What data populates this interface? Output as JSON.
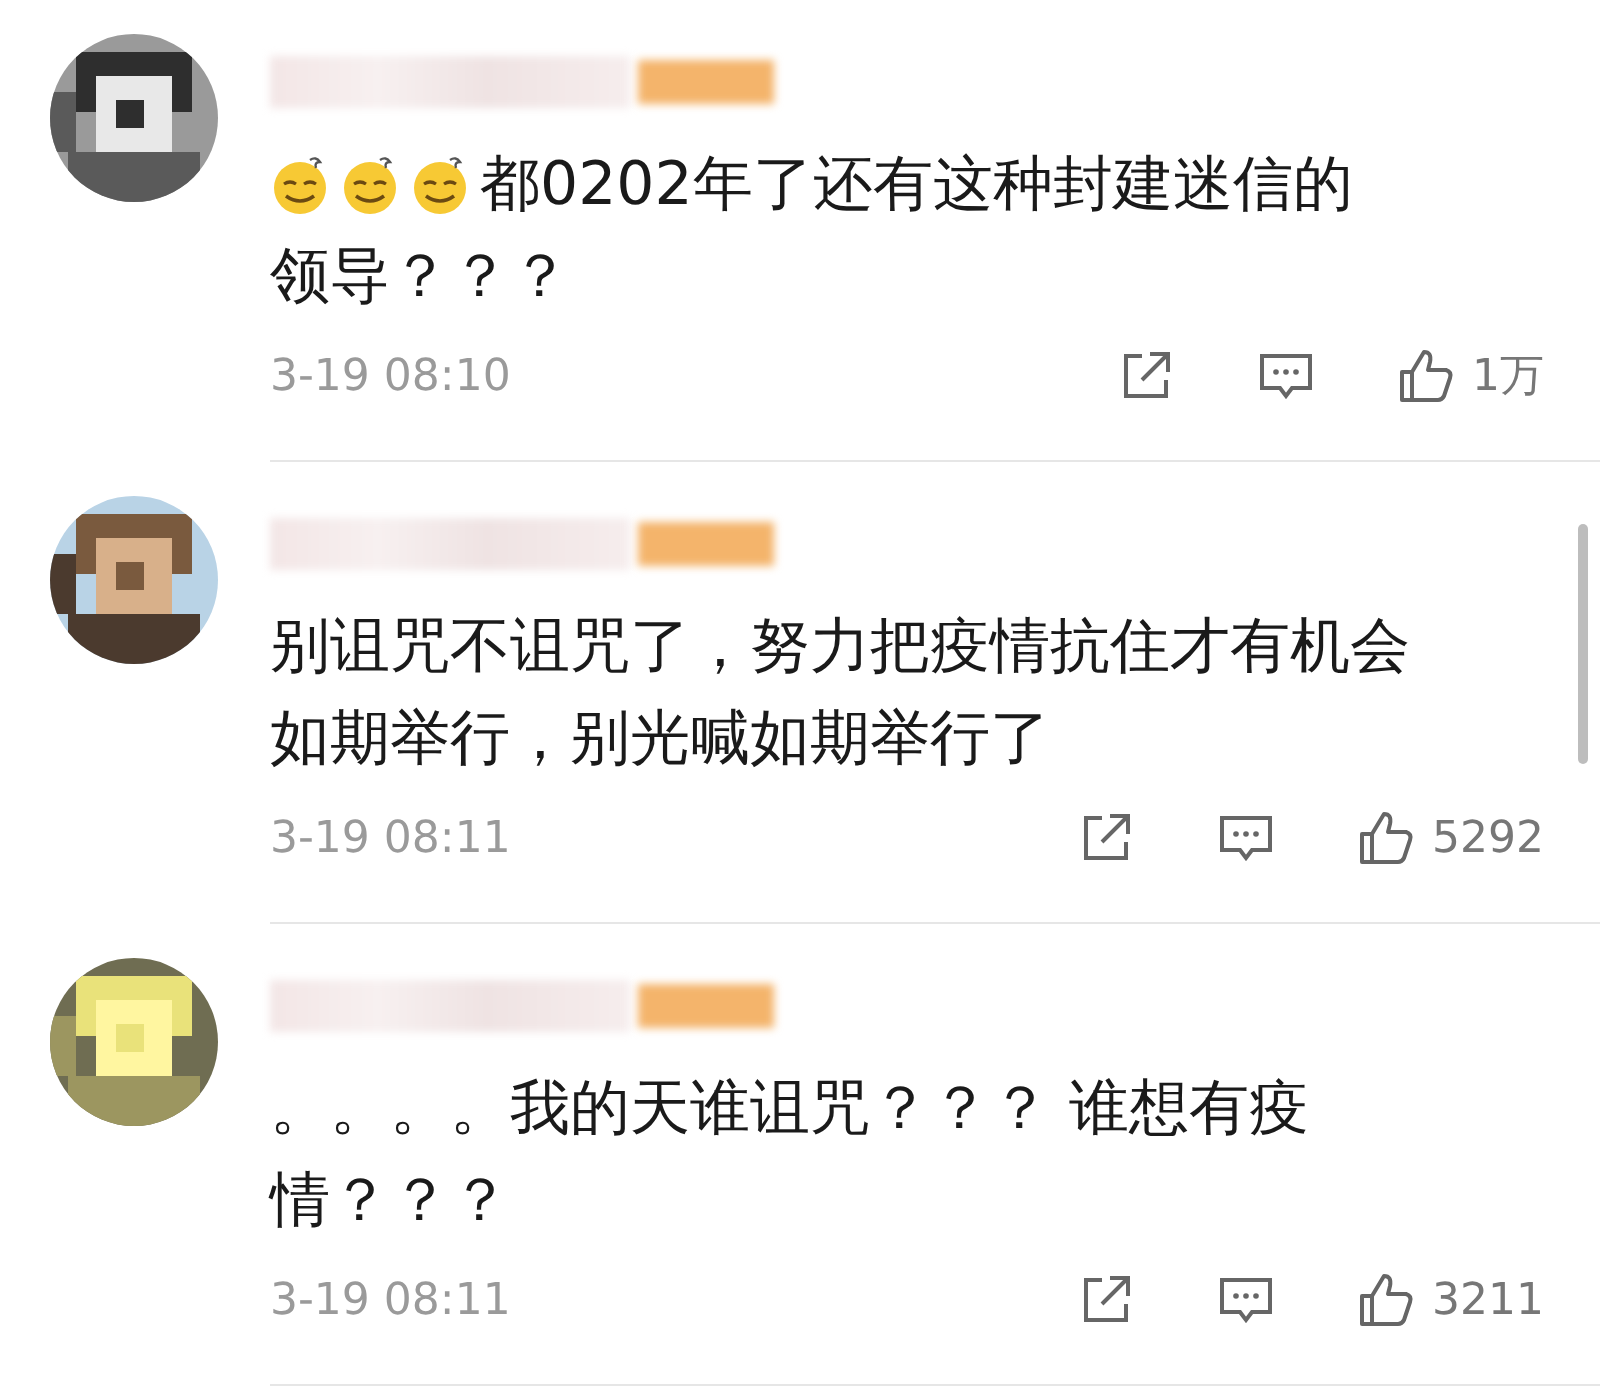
{
  "comments": [
    {
      "lead_emojis": [
        {
          "kind": "sweat-smile"
        },
        {
          "kind": "sweat-smile"
        },
        {
          "kind": "sweat-smile"
        }
      ],
      "lines": [
        "都0202年了还有这种封建迷信的",
        "领导？？？"
      ],
      "time": "3-19 08:10",
      "likes": "1万"
    },
    {
      "lines": [
        "别诅咒不诅咒了，努力把疫情抗住才有机会",
        "如期举行，别光喊如期举行了"
      ],
      "time": "3-19 08:11",
      "likes": "5292"
    },
    {
      "lines": [
        "。。。。我的天谁诅咒？？？ 谁想有疫",
        "情？？？"
      ],
      "time": "3-19 08:11",
      "likes": "3211"
    }
  ]
}
